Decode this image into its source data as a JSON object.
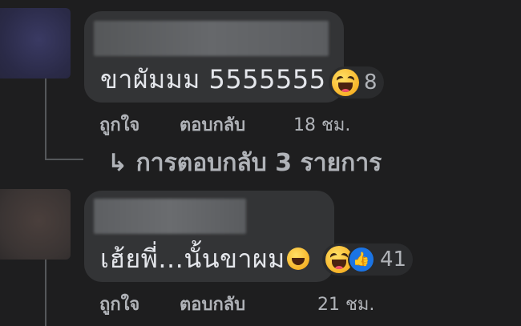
{
  "comments": [
    {
      "text": "ขาผัมมม 5555555",
      "reaction_icons": [
        "haha-emoji-icon"
      ],
      "reaction_count": "8",
      "like_label": "ถูกใจ",
      "reply_label": "ตอบกลับ",
      "time": "18 ชม.",
      "replies_label": "การตอบกลับ 3 รายการ"
    },
    {
      "text": "เฮ้ยพี่...นั้นขาผม",
      "reaction_icons": [
        "haha-emoji-icon",
        "like-thumb-icon"
      ],
      "reaction_count": "41",
      "like_label": "ถูกใจ",
      "reply_label": "ตอบกลับ",
      "time": "21 ชม."
    }
  ],
  "colors": {
    "background": "#1e1e1f",
    "bubble": "#333436",
    "secondary_text": "#b0b3b8",
    "like_blue": "#1b74e4"
  }
}
